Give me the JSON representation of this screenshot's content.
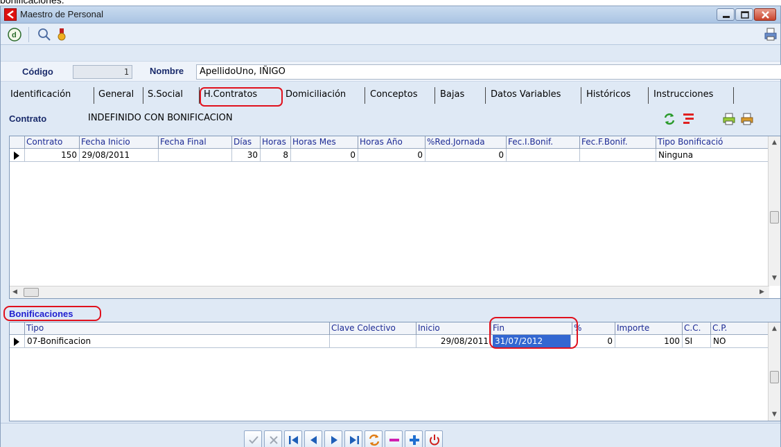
{
  "top_cut_text": "bonificaciones.",
  "window": {
    "title": "Maestro de Personal"
  },
  "toolbar": {
    "icons": [
      "d-logo-icon",
      "search-icon",
      "medal-icon",
      "print-icon"
    ]
  },
  "header": {
    "codigo_label": "Código",
    "codigo_value": "1",
    "nombre_label": "Nombre",
    "nombre_value": "ApellidoUno, IÑIGO"
  },
  "tabs": [
    {
      "label": "Identificación"
    },
    {
      "label": "General"
    },
    {
      "label": "S.Social"
    },
    {
      "label": "H.Contratos"
    },
    {
      "label": "Domiciliación"
    },
    {
      "label": "Conceptos"
    },
    {
      "label": "Bajas"
    },
    {
      "label": "Datos Variables"
    },
    {
      "label": "Históricos"
    },
    {
      "label": "Instrucciones"
    }
  ],
  "contrato": {
    "label": "Contrato",
    "value": "INDEFINIDO CON BONIFICACION"
  },
  "contracts_grid": {
    "columns": [
      "Contrato",
      "Fecha Inicio",
      "Fecha Final",
      "Días",
      "Horas",
      "Horas Mes",
      "Horas Año",
      "%Red.Jornada",
      "Fec.I.Bonif.",
      "Fec.F.Bonif.",
      "Tipo Bonificació"
    ],
    "rows": [
      [
        "150",
        "29/08/2011",
        "",
        "30",
        "8",
        "0",
        "0",
        "0",
        "",
        "",
        "Ninguna"
      ]
    ]
  },
  "bonificaciones": {
    "label": "Bonificaciones",
    "columns": [
      "Tipo",
      "Clave Colectivo",
      "Inicio",
      "Fin",
      "%",
      "Importe",
      "C.C.",
      "C.P."
    ],
    "rows": [
      [
        "07-Bonificacion",
        "",
        "29/08/2011",
        "31/07/2012",
        "0",
        "100",
        "SI",
        "NO"
      ]
    ]
  },
  "colors": {
    "highlight": "#e0101c",
    "header_text": "#1c2a94",
    "selection": "#3367d1"
  }
}
